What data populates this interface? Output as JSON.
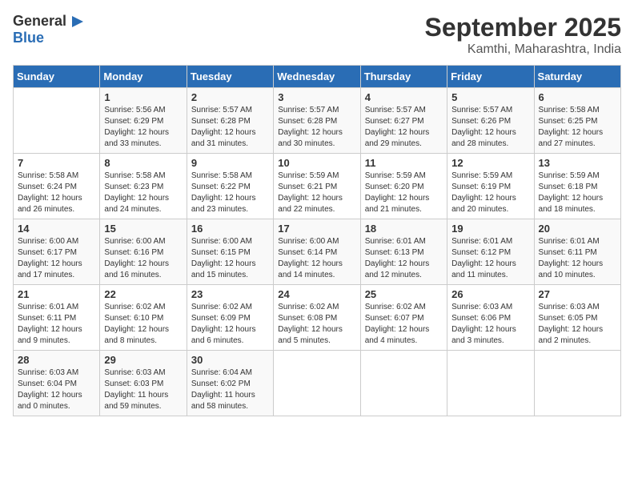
{
  "header": {
    "logo_general": "General",
    "logo_blue": "Blue",
    "title": "September 2025",
    "subtitle": "Kamthi, Maharashtra, India"
  },
  "days_of_week": [
    "Sunday",
    "Monday",
    "Tuesday",
    "Wednesday",
    "Thursday",
    "Friday",
    "Saturday"
  ],
  "weeks": [
    [
      {
        "day": null,
        "info": null
      },
      {
        "day": "1",
        "info": "Sunrise: 5:56 AM\nSunset: 6:29 PM\nDaylight: 12 hours\nand 33 minutes."
      },
      {
        "day": "2",
        "info": "Sunrise: 5:57 AM\nSunset: 6:28 PM\nDaylight: 12 hours\nand 31 minutes."
      },
      {
        "day": "3",
        "info": "Sunrise: 5:57 AM\nSunset: 6:28 PM\nDaylight: 12 hours\nand 30 minutes."
      },
      {
        "day": "4",
        "info": "Sunrise: 5:57 AM\nSunset: 6:27 PM\nDaylight: 12 hours\nand 29 minutes."
      },
      {
        "day": "5",
        "info": "Sunrise: 5:57 AM\nSunset: 6:26 PM\nDaylight: 12 hours\nand 28 minutes."
      },
      {
        "day": "6",
        "info": "Sunrise: 5:58 AM\nSunset: 6:25 PM\nDaylight: 12 hours\nand 27 minutes."
      }
    ],
    [
      {
        "day": "7",
        "info": "Sunrise: 5:58 AM\nSunset: 6:24 PM\nDaylight: 12 hours\nand 26 minutes."
      },
      {
        "day": "8",
        "info": "Sunrise: 5:58 AM\nSunset: 6:23 PM\nDaylight: 12 hours\nand 24 minutes."
      },
      {
        "day": "9",
        "info": "Sunrise: 5:58 AM\nSunset: 6:22 PM\nDaylight: 12 hours\nand 23 minutes."
      },
      {
        "day": "10",
        "info": "Sunrise: 5:59 AM\nSunset: 6:21 PM\nDaylight: 12 hours\nand 22 minutes."
      },
      {
        "day": "11",
        "info": "Sunrise: 5:59 AM\nSunset: 6:20 PM\nDaylight: 12 hours\nand 21 minutes."
      },
      {
        "day": "12",
        "info": "Sunrise: 5:59 AM\nSunset: 6:19 PM\nDaylight: 12 hours\nand 20 minutes."
      },
      {
        "day": "13",
        "info": "Sunrise: 5:59 AM\nSunset: 6:18 PM\nDaylight: 12 hours\nand 18 minutes."
      }
    ],
    [
      {
        "day": "14",
        "info": "Sunrise: 6:00 AM\nSunset: 6:17 PM\nDaylight: 12 hours\nand 17 minutes."
      },
      {
        "day": "15",
        "info": "Sunrise: 6:00 AM\nSunset: 6:16 PM\nDaylight: 12 hours\nand 16 minutes."
      },
      {
        "day": "16",
        "info": "Sunrise: 6:00 AM\nSunset: 6:15 PM\nDaylight: 12 hours\nand 15 minutes."
      },
      {
        "day": "17",
        "info": "Sunrise: 6:00 AM\nSunset: 6:14 PM\nDaylight: 12 hours\nand 14 minutes."
      },
      {
        "day": "18",
        "info": "Sunrise: 6:01 AM\nSunset: 6:13 PM\nDaylight: 12 hours\nand 12 minutes."
      },
      {
        "day": "19",
        "info": "Sunrise: 6:01 AM\nSunset: 6:12 PM\nDaylight: 12 hours\nand 11 minutes."
      },
      {
        "day": "20",
        "info": "Sunrise: 6:01 AM\nSunset: 6:11 PM\nDaylight: 12 hours\nand 10 minutes."
      }
    ],
    [
      {
        "day": "21",
        "info": "Sunrise: 6:01 AM\nSunset: 6:11 PM\nDaylight: 12 hours\nand 9 minutes."
      },
      {
        "day": "22",
        "info": "Sunrise: 6:02 AM\nSunset: 6:10 PM\nDaylight: 12 hours\nand 8 minutes."
      },
      {
        "day": "23",
        "info": "Sunrise: 6:02 AM\nSunset: 6:09 PM\nDaylight: 12 hours\nand 6 minutes."
      },
      {
        "day": "24",
        "info": "Sunrise: 6:02 AM\nSunset: 6:08 PM\nDaylight: 12 hours\nand 5 minutes."
      },
      {
        "day": "25",
        "info": "Sunrise: 6:02 AM\nSunset: 6:07 PM\nDaylight: 12 hours\nand 4 minutes."
      },
      {
        "day": "26",
        "info": "Sunrise: 6:03 AM\nSunset: 6:06 PM\nDaylight: 12 hours\nand 3 minutes."
      },
      {
        "day": "27",
        "info": "Sunrise: 6:03 AM\nSunset: 6:05 PM\nDaylight: 12 hours\nand 2 minutes."
      }
    ],
    [
      {
        "day": "28",
        "info": "Sunrise: 6:03 AM\nSunset: 6:04 PM\nDaylight: 12 hours\nand 0 minutes."
      },
      {
        "day": "29",
        "info": "Sunrise: 6:03 AM\nSunset: 6:03 PM\nDaylight: 11 hours\nand 59 minutes."
      },
      {
        "day": "30",
        "info": "Sunrise: 6:04 AM\nSunset: 6:02 PM\nDaylight: 11 hours\nand 58 minutes."
      },
      {
        "day": null,
        "info": null
      },
      {
        "day": null,
        "info": null
      },
      {
        "day": null,
        "info": null
      },
      {
        "day": null,
        "info": null
      }
    ]
  ]
}
